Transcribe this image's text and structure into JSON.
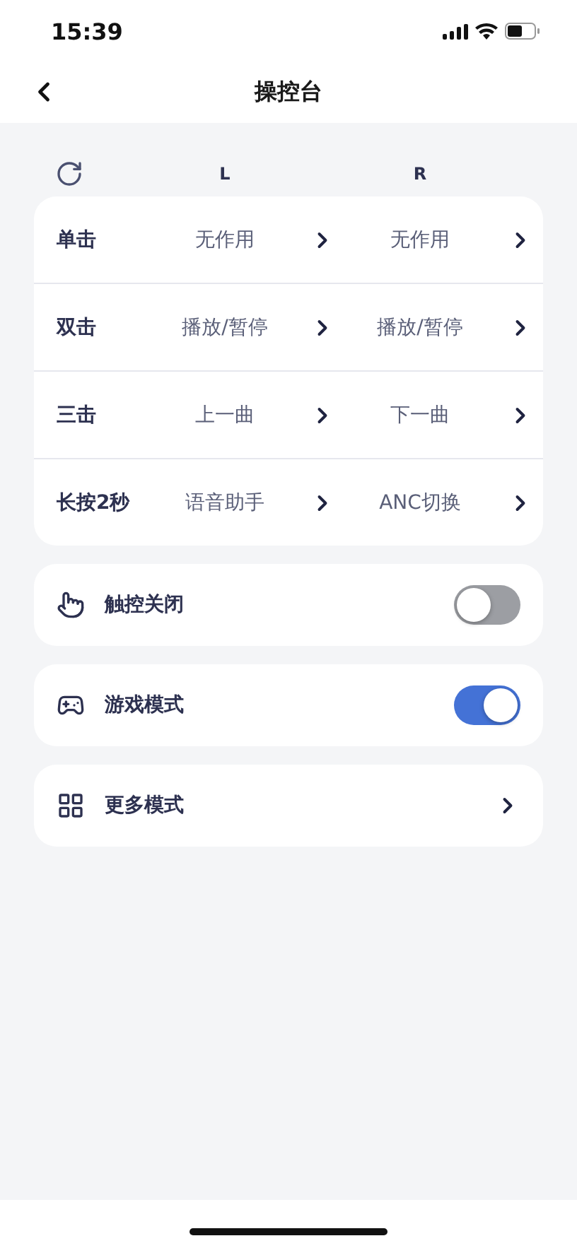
{
  "status_bar": {
    "time": "15:39"
  },
  "nav": {
    "title": "操控台"
  },
  "table": {
    "columns": [
      "L",
      "R"
    ],
    "rows": [
      {
        "gesture": "单击",
        "left": "无作用",
        "right": "无作用"
      },
      {
        "gesture": "双击",
        "left": "播放/暂停",
        "right": "播放/暂停"
      },
      {
        "gesture": "三击",
        "left": "上一曲",
        "right": "下一曲"
      },
      {
        "gesture": "长按2秒",
        "left": "语音助手",
        "right": "ANC切换"
      }
    ]
  },
  "settings": [
    {
      "kind": "toggle",
      "label": "触控关闭",
      "on": false
    },
    {
      "kind": "toggle",
      "label": "游戏模式",
      "on": true
    },
    {
      "kind": "link",
      "label": "更多模式"
    }
  ]
}
